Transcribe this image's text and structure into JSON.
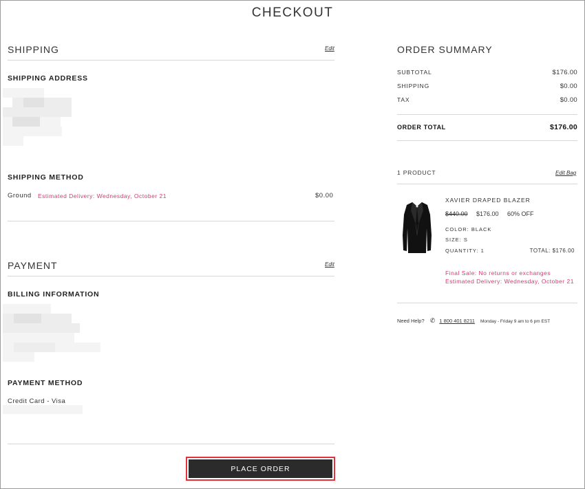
{
  "page": {
    "title": "CHECKOUT"
  },
  "shipping": {
    "heading": "SHIPPING",
    "edit_label": "Edit",
    "address_heading": "SHIPPING ADDRESS",
    "method_heading": "SHIPPING METHOD",
    "method_name": "Ground",
    "estimated_delivery": "Estimated Delivery: Wednesday, October 21",
    "method_price": "$0.00"
  },
  "payment": {
    "heading": "PAYMENT",
    "edit_label": "Edit",
    "billing_heading": "BILLING INFORMATION",
    "method_heading": "PAYMENT METHOD",
    "method_value": "Credit Card - Visa"
  },
  "summary": {
    "heading": "ORDER SUMMARY",
    "rows": [
      {
        "label": "SUBTOTAL",
        "value": "$176.00"
      },
      {
        "label": "SHIPPING",
        "value": "$0.00"
      },
      {
        "label": "TAX",
        "value": "$0.00"
      }
    ],
    "total_label": "ORDER TOTAL",
    "total_value": "$176.00",
    "product_count": "1 PRODUCT",
    "edit_bag": "Edit Bag"
  },
  "product": {
    "name": "XAVIER DRAPED BLAZER",
    "original_price": "$440.00",
    "sale_price": "$176.00",
    "discount": "60% OFF",
    "color": "COLOR: BLACK",
    "size": "SIZE: S",
    "quantity": "QUANTITY: 1",
    "total": "TOTAL: $176.00",
    "final_sale": "Final Sale: No returns or exchanges",
    "estimated_delivery": "Estimated Delivery: Wednesday, October 21"
  },
  "help": {
    "label": "Need Help?",
    "phone": "1 800 401 8211",
    "hours": "Monday - Friday 9 am to 6 pm EST"
  },
  "actions": {
    "place_order": "PLACE ORDER"
  },
  "colors": {
    "accent_pink": "#d23a73",
    "button_bg": "#2b2b2b",
    "focus_outline": "#e3303a"
  }
}
